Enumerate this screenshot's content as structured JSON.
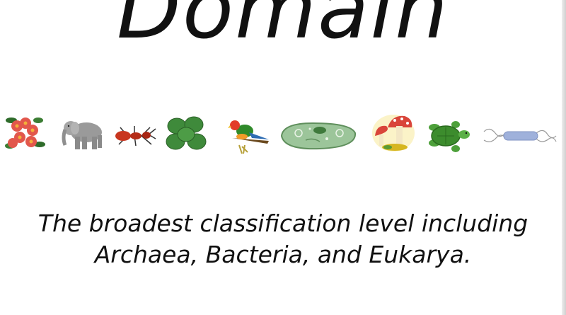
{
  "slide": {
    "title": "Domain",
    "caption_line_1": "The broadest classification level including",
    "caption_line_2": "Archaea, Bacteria, and Eukarya."
  },
  "icons": [
    "flower-icon",
    "elephant-icon",
    "ant-icon",
    "leaves-icon",
    "parrot-icon",
    "paramecium-icon",
    "mushroom-icon",
    "turtle-icon",
    "bacterium-icon"
  ],
  "colors": {
    "background": "#ffffff",
    "text": "#111111"
  }
}
